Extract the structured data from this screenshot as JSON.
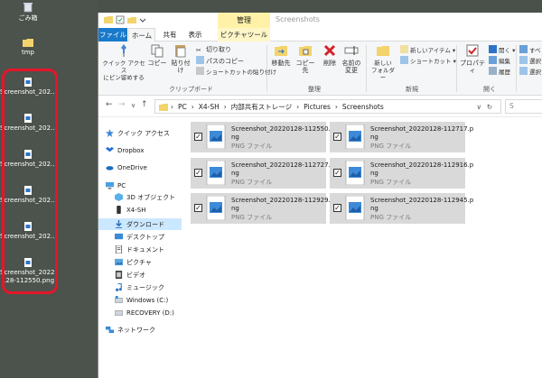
{
  "desktop": {
    "items": [
      {
        "label": "ごみ箱",
        "icon": "recycle-bin-icon"
      },
      {
        "label": "tmp",
        "icon": "folder-icon"
      },
      {
        "label": "Screenshot_202...",
        "icon": "png-file-icon"
      },
      {
        "label": "Screenshot_202...",
        "icon": "png-file-icon"
      },
      {
        "label": "Screenshot_202...",
        "icon": "png-file-icon"
      },
      {
        "label": "Screenshot_202...",
        "icon": "png-file-icon"
      },
      {
        "label": "Screenshot_202...",
        "icon": "png-file-icon"
      },
      {
        "label1": "Screenshot_20220",
        "label2": "128-112550.png",
        "icon": "png-file-icon"
      }
    ],
    "highlight_color": "#e4162a"
  },
  "window": {
    "context_tab": "管理",
    "title": "Screenshots",
    "tabs": {
      "file": "ファイル",
      "home": "ホーム",
      "share": "共有",
      "view": "表示",
      "picture_tools": "ピクチャツール"
    },
    "ribbon": {
      "quick_access": "クイック アクセス\nにピン留めする",
      "copy": "コピー",
      "paste": "貼り付け",
      "cut": "切り取り",
      "copy_path": "パスのコピー",
      "paste_shortcut": "ショートカットの貼り付け",
      "clipboard_group": "クリップボード",
      "move_to": "移動先",
      "copy_to": "コピー先",
      "delete": "削除",
      "rename": "名前の\n変更",
      "organize_group": "整理",
      "new_folder": "新しい\nフォルダー",
      "new_item": "新しいアイテム",
      "shortcut": "ショートカット",
      "new_group": "新規",
      "properties": "プロパティ",
      "open": "開く",
      "edit": "編集",
      "history": "履歴",
      "open_group": "開く",
      "select_all": "すべ",
      "select_none": "選択",
      "invert": "選択"
    },
    "address": {
      "parts": [
        "PC",
        "X4-SH",
        "内部共有ストレージ",
        "Pictures",
        "Screenshots"
      ],
      "search_placeholder": "S"
    },
    "nav": [
      {
        "label": "クイック アクセス",
        "icon": "star-icon"
      },
      {
        "label": "Dropbox",
        "icon": "dropbox-icon"
      },
      {
        "label": "OneDrive",
        "icon": "cloud-icon"
      },
      {
        "label": "PC",
        "icon": "pc-icon"
      },
      {
        "label": "3D オブジェクト",
        "icon": "cube-icon"
      },
      {
        "label": "X4-SH",
        "icon": "phone-icon"
      },
      {
        "label": "ダウンロード",
        "icon": "download-icon"
      },
      {
        "label": "デスクトップ",
        "icon": "desktop-icon"
      },
      {
        "label": "ドキュメント",
        "icon": "document-icon"
      },
      {
        "label": "ピクチャ",
        "icon": "pictures-icon"
      },
      {
        "label": "ビデオ",
        "icon": "video-icon"
      },
      {
        "label": "ミュージック",
        "icon": "music-icon"
      },
      {
        "label": "Windows (C:)",
        "icon": "drive-icon"
      },
      {
        "label": "RECOVERY (D:)",
        "icon": "drive-icon"
      },
      {
        "label": "ネットワーク",
        "icon": "network-icon"
      }
    ],
    "files": [
      {
        "name1": "Screenshot_20220128-112550.p",
        "name2": "ng",
        "type": "PNG ファイル"
      },
      {
        "name1": "Screenshot_20220128-112717.p",
        "name2": "ng",
        "type": "PNG ファイル"
      },
      {
        "name1": "Screenshot_20220128-112727.p",
        "name2": "ng",
        "type": "PNG ファイル"
      },
      {
        "name1": "Screenshot_20220128-112916.p",
        "name2": "ng",
        "type": "PNG ファイル"
      },
      {
        "name1": "Screenshot_20220128-112929.p",
        "name2": "ng",
        "type": "PNG ファイル"
      },
      {
        "name1": "Screenshot_20220128-112945.p",
        "name2": "ng",
        "type": "PNG ファイル"
      }
    ],
    "check_mark": "✓"
  }
}
